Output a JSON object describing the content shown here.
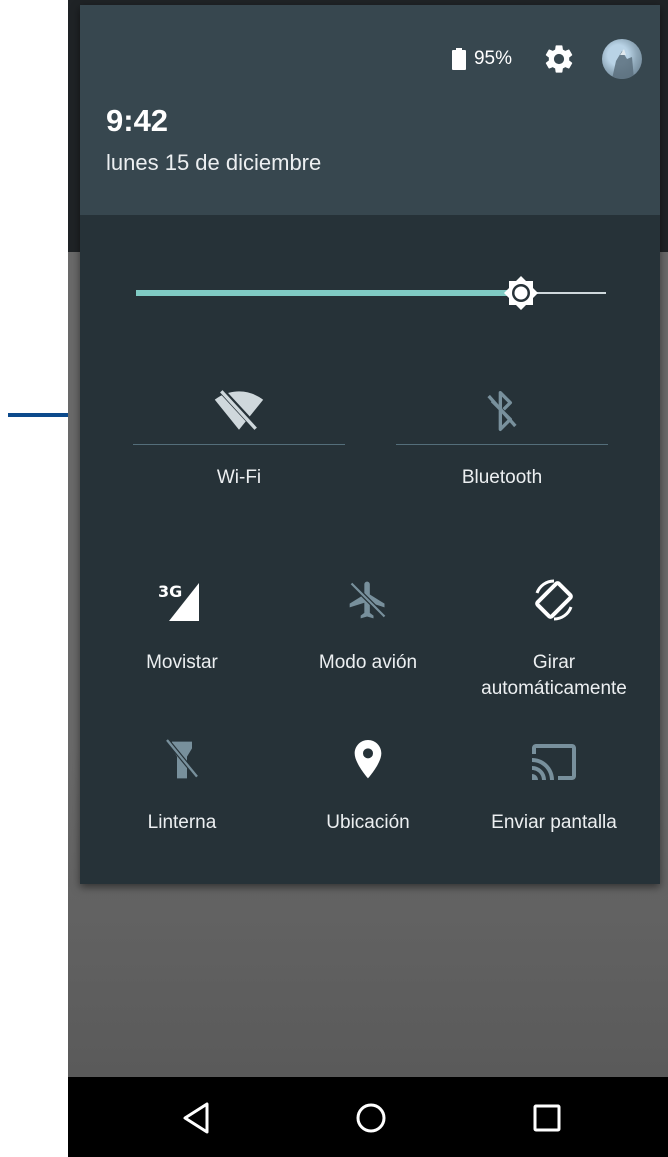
{
  "status": {
    "battery_percent": "95%"
  },
  "header": {
    "time": "9:42",
    "date": "lunes 15 de diciembre"
  },
  "brightness": {
    "level": 0.82
  },
  "tiles_primary": [
    {
      "label": "Wi-Fi",
      "icon": "wifi-off-icon",
      "enabled": false
    },
    {
      "label": "Bluetooth",
      "icon": "bluetooth-disabled-icon",
      "enabled": false
    }
  ],
  "tiles": [
    {
      "label": "Movistar",
      "icon": "signal-3g-icon"
    },
    {
      "label": "Modo avión",
      "icon": "airplane-icon"
    },
    {
      "label_line1": "Girar",
      "label_line2": "automáticamente",
      "icon": "screen-rotation-icon"
    },
    {
      "label": "Linterna",
      "icon": "flashlight-off-icon"
    },
    {
      "label": "Ubicación",
      "icon": "location-pin-icon"
    },
    {
      "label": "Enviar pantalla",
      "icon": "cast-icon"
    }
  ],
  "navbar": {
    "icons": [
      "back-icon",
      "home-icon",
      "recents-icon"
    ]
  },
  "colors": {
    "panel": "#263238",
    "header": "#37474f",
    "accent": "#80cbc4",
    "arrow": "#0d4a8c"
  }
}
